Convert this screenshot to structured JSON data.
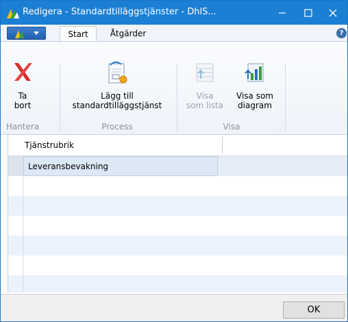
{
  "window": {
    "title": "Redigera - Standardtilläggstjänster - DhlS...",
    "controls": {
      "minimize": "—",
      "maximize": "☐",
      "close": "✕"
    }
  },
  "tabs": [
    {
      "label": "Start",
      "active": true
    },
    {
      "label": "Åtgärder",
      "active": false
    }
  ],
  "help_icon": "?",
  "ribbon": {
    "groups": [
      {
        "label": "Hantera",
        "buttons": [
          {
            "label1": "Ta",
            "label2": "bort",
            "icon": "delete-x-icon",
            "enabled": true
          }
        ]
      },
      {
        "label": "Process",
        "buttons": [
          {
            "label1": "Lägg till",
            "label2": "standardtilläggstjänst",
            "icon": "document-add-icon",
            "enabled": true
          }
        ]
      },
      {
        "label": "Visa",
        "buttons": [
          {
            "label1": "Visa",
            "label2": "som lista",
            "icon": "list-view-icon",
            "enabled": false
          },
          {
            "label1": "Visa som",
            "label2": "diagram",
            "icon": "chart-view-icon",
            "enabled": true
          }
        ]
      }
    ]
  },
  "grid": {
    "column_header": "Tjänstrubrik",
    "rows": [
      "Leveransbevakning"
    ]
  },
  "footer": {
    "ok_label": "OK"
  },
  "colors": {
    "titlebar": "#1b7fd4",
    "delete_red": "#d62b2b",
    "row_alt": "#eaf2fb"
  }
}
